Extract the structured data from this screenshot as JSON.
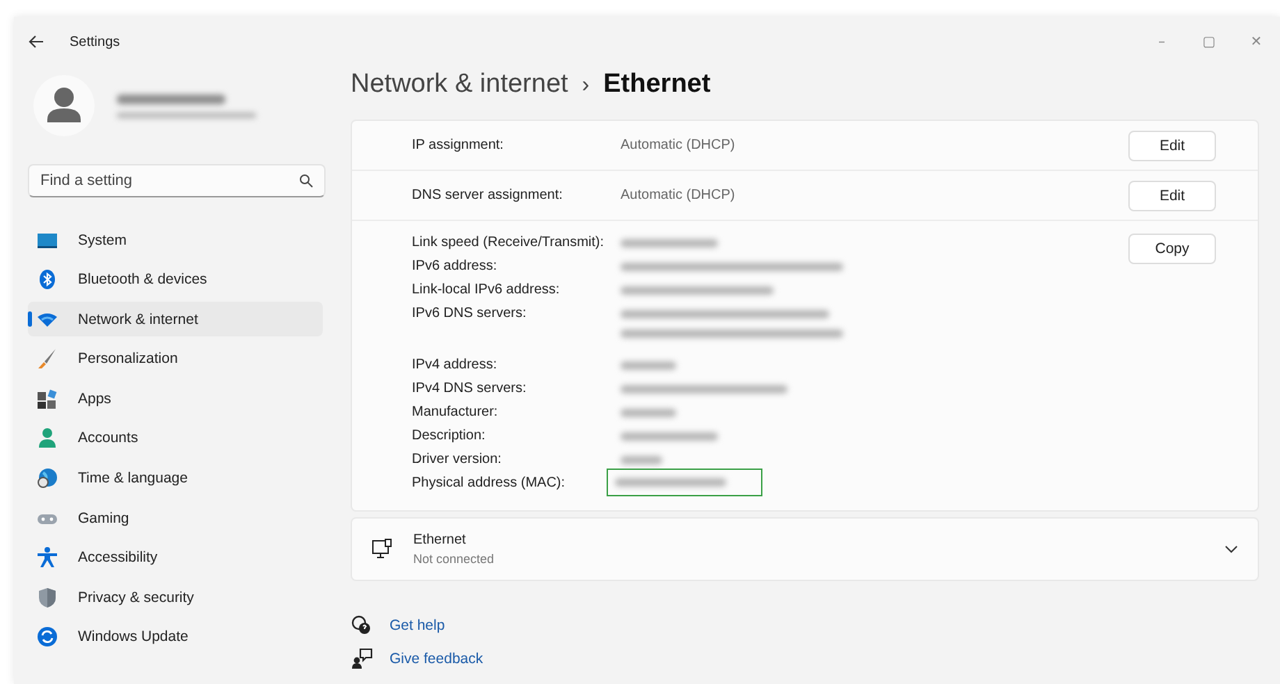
{
  "window": {
    "title": "Settings",
    "controls": [
      "–",
      "▢",
      "✕"
    ]
  },
  "search": {
    "placeholder": "Find a setting"
  },
  "sidebar": {
    "items": [
      {
        "label": "System",
        "selected": false
      },
      {
        "label": "Bluetooth & devices",
        "selected": false
      },
      {
        "label": "Network & internet",
        "selected": true
      },
      {
        "label": "Personalization",
        "selected": false
      },
      {
        "label": "Apps",
        "selected": false
      },
      {
        "label": "Accounts",
        "selected": false
      },
      {
        "label": "Time & language",
        "selected": false
      },
      {
        "label": "Gaming",
        "selected": false
      },
      {
        "label": "Accessibility",
        "selected": false
      },
      {
        "label": "Privacy & security",
        "selected": false
      },
      {
        "label": "Windows Update",
        "selected": false
      }
    ]
  },
  "breadcrumb": {
    "parent": "Network & internet",
    "separator": "›",
    "current": "Ethernet"
  },
  "settings": [
    {
      "label": "IP assignment:",
      "value": "Automatic (DHCP)",
      "button": "Edit"
    },
    {
      "label": "DNS server assignment:",
      "value": "Automatic (DHCP)",
      "button": "Edit"
    }
  ],
  "properties": {
    "button": "Copy",
    "rows": [
      {
        "label": "Link speed (Receive/Transmit):",
        "values": [
          {
            "kind": "blurred"
          }
        ],
        "highlighted": false
      },
      {
        "label": "IPv6 address:",
        "values": [
          {
            "kind": "blurred"
          }
        ],
        "highlighted": false
      },
      {
        "label": "Link-local IPv6 address:",
        "values": [
          {
            "kind": "blurred"
          }
        ],
        "highlighted": false
      },
      {
        "label": "IPv6 DNS servers:",
        "values": [
          {
            "kind": "blurred"
          },
          {
            "kind": "blurred"
          }
        ],
        "highlighted": false
      },
      {
        "label": "IPv4 address:",
        "values": [
          {
            "kind": "blurred"
          }
        ],
        "highlighted": false
      },
      {
        "label": "IPv4 DNS servers:",
        "values": [
          {
            "kind": "blurred"
          }
        ],
        "highlighted": false
      },
      {
        "label": "Manufacturer:",
        "values": [
          {
            "kind": "blurred"
          }
        ],
        "highlighted": false
      },
      {
        "label": "Description:",
        "values": [
          {
            "kind": "blurred"
          }
        ],
        "highlighted": false
      },
      {
        "label": "Driver version:",
        "values": [
          {
            "kind": "blurred"
          }
        ],
        "highlighted": false
      },
      {
        "label": "Physical address (MAC):",
        "values": [
          {
            "kind": "blurred"
          }
        ],
        "highlighted": true
      }
    ]
  },
  "adapter": {
    "name": "Ethernet",
    "status": "Not connected",
    "expanded": false
  },
  "links": [
    {
      "label": "Get help"
    },
    {
      "label": "Give feedback"
    }
  ]
}
